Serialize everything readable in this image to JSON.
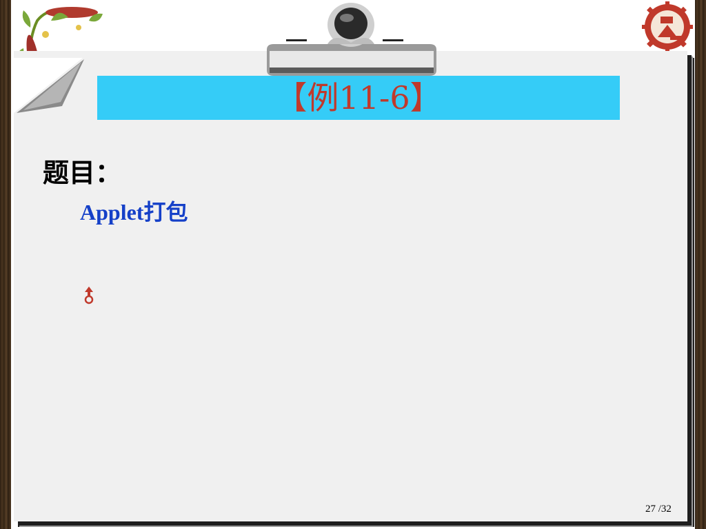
{
  "slide": {
    "title": "【例11-6】",
    "question_label": "题目：",
    "question_text": "Applet打包",
    "page_number": "27 /32"
  },
  "icons": {
    "link": "hyperlink-action-icon",
    "logo": "university-gear-seal-icon",
    "clip": "clipboard-clip-icon"
  },
  "colors": {
    "title_bar": "#35ccf7",
    "title_text": "#c0392b",
    "subtitle_text": "#1540c8",
    "sheet": "#f0f0f0"
  }
}
